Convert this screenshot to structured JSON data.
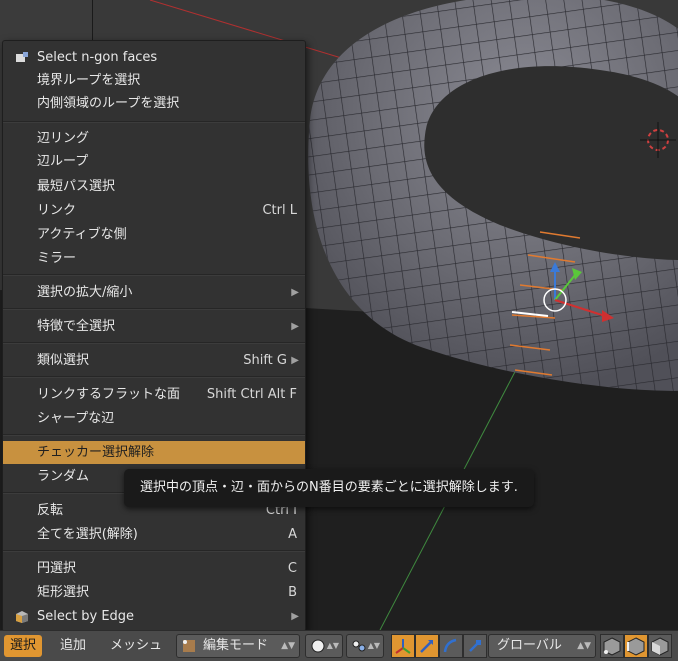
{
  "menu": {
    "items": [
      {
        "label": "Select n-gon faces",
        "shortcut": "",
        "submenu": false,
        "icon": "ngon-select-icon"
      },
      {
        "label": "境界ループを選択",
        "shortcut": "",
        "submenu": false
      },
      {
        "label": "内側領域のループを選択",
        "shortcut": "",
        "submenu": false
      },
      {
        "label": "辺リング",
        "shortcut": "",
        "submenu": false
      },
      {
        "label": "辺ループ",
        "shortcut": "",
        "submenu": false
      },
      {
        "label": "最短パス選択",
        "shortcut": "",
        "submenu": false
      },
      {
        "label": "リンク",
        "shortcut": "Ctrl L",
        "submenu": false
      },
      {
        "label": "アクティブな側",
        "shortcut": "",
        "submenu": false
      },
      {
        "label": "ミラー",
        "shortcut": "",
        "submenu": false
      },
      {
        "label": "選択の拡大/縮小",
        "shortcut": "",
        "submenu": true
      },
      {
        "label": "特徴で全選択",
        "shortcut": "",
        "submenu": true
      },
      {
        "label": "類似選択",
        "shortcut": "Shift G",
        "submenu": true
      },
      {
        "label": "リンクするフラットな面",
        "shortcut": "Shift Ctrl Alt F",
        "submenu": false
      },
      {
        "label": "シャープな辺",
        "shortcut": "",
        "submenu": false
      },
      {
        "label": "チェッカー選択解除",
        "shortcut": "",
        "submenu": false,
        "highlighted": true
      },
      {
        "label": "ランダム",
        "shortcut": "",
        "submenu": false
      },
      {
        "label": "反転",
        "shortcut": "Ctrl I",
        "submenu": false
      },
      {
        "label": "全てを選択(解除)",
        "shortcut": "A",
        "submenu": false
      },
      {
        "label": "円選択",
        "shortcut": "C",
        "submenu": false
      },
      {
        "label": "矩形選択",
        "shortcut": "B",
        "submenu": false
      },
      {
        "label": "Select by Edge",
        "shortcut": "",
        "submenu": true,
        "icon": "cube-icon"
      }
    ]
  },
  "tooltip": {
    "text": "選択中の頂点・辺・面からのN番目の要素ごとに選択解除します."
  },
  "header": {
    "select": "選択",
    "add": "追加",
    "mesh": "メッシュ",
    "mode": "編集モード",
    "orientation": "グローバル"
  },
  "colors": {
    "highlight": "#c8913f",
    "active_tab": "#e09631",
    "menu_bg": "#323232",
    "tooltip_bg": "#1a1a1a"
  }
}
